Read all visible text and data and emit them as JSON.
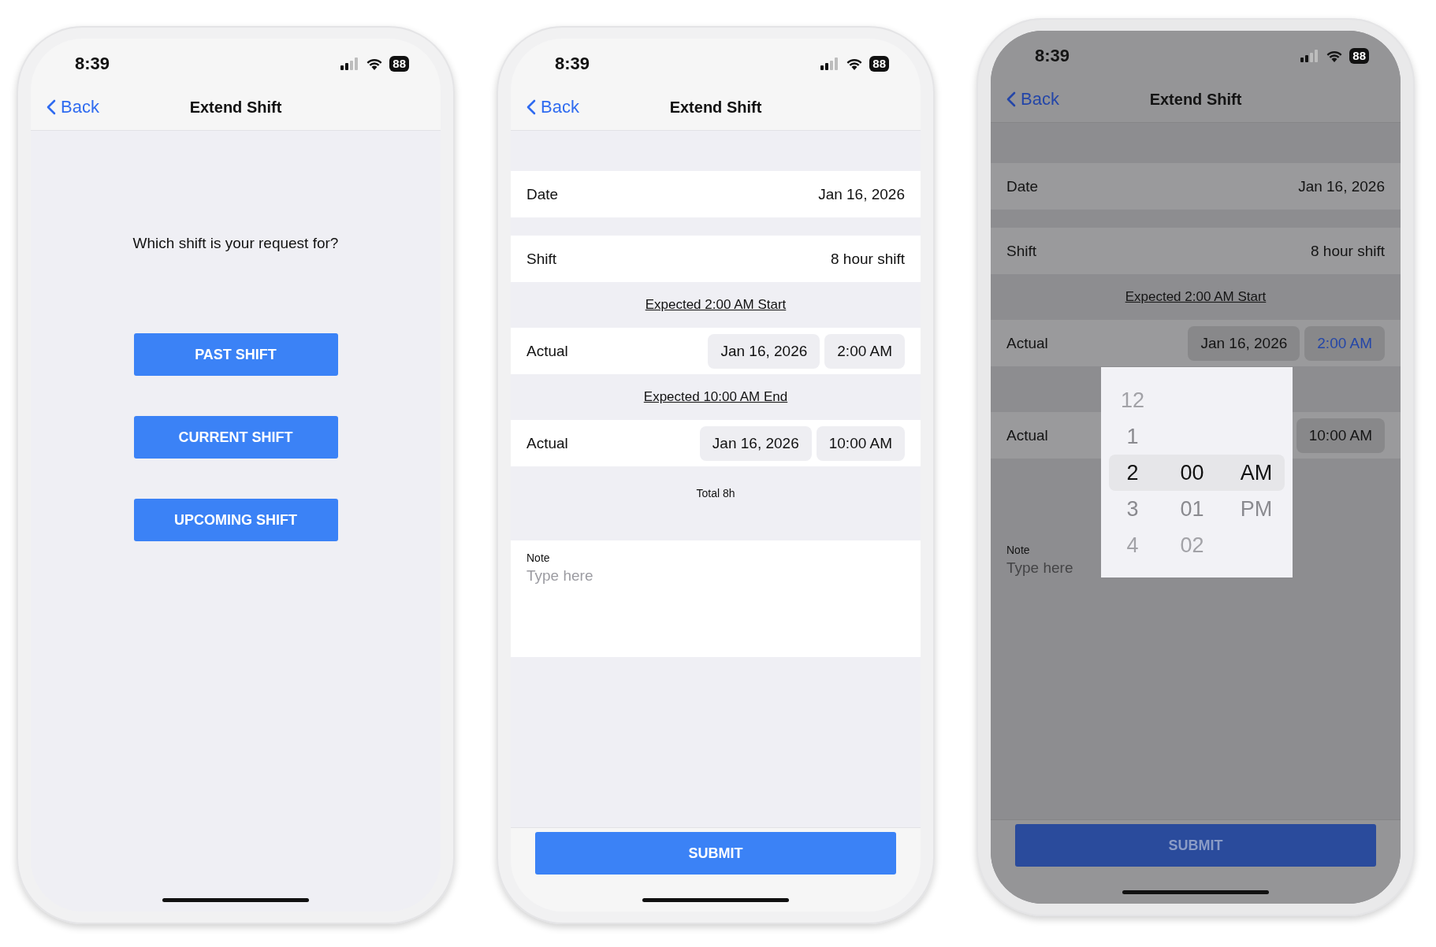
{
  "screens": [
    {
      "kind": "chooser",
      "dimmed": false,
      "status": {
        "time": "8:39",
        "battery": "88"
      },
      "nav": {
        "back": "Back",
        "title": "Extend Shift"
      },
      "prompt": "Which shift is your request for?",
      "buttons": [
        "PAST SHIFT",
        "CURRENT SHIFT",
        "UPCOMING SHIFT"
      ]
    },
    {
      "kind": "form",
      "dimmed": false,
      "status": {
        "time": "8:39",
        "battery": "88"
      },
      "nav": {
        "back": "Back",
        "title": "Extend Shift"
      },
      "rows": [
        {
          "kind": "field",
          "label": "Date",
          "value": "Jan 16, 2026"
        },
        {
          "kind": "field",
          "label": "Shift",
          "value": "8 hour shift"
        },
        {
          "kind": "header",
          "text": "Expected 2:00 AM Start"
        },
        {
          "kind": "actual",
          "label": "Actual",
          "date": "Jan 16, 2026",
          "time": {
            "text": "2:00 AM",
            "selected": false
          }
        },
        {
          "kind": "header",
          "text": "Expected 10:00 AM End"
        },
        {
          "kind": "actual",
          "label": "Actual",
          "date": "Jan 16, 2026",
          "time": {
            "text": "10:00 AM",
            "selected": false
          }
        }
      ],
      "total": "Total 8h",
      "note": {
        "label": "Note",
        "placeholder": "Type here"
      },
      "submit": "SUBMIT"
    },
    {
      "kind": "form",
      "dimmed": true,
      "status": {
        "time": "8:39",
        "battery": "88"
      },
      "nav": {
        "back": "Back",
        "title": "Extend Shift"
      },
      "rows": [
        {
          "kind": "field",
          "label": "Date",
          "value": "Jan 16, 2026"
        },
        {
          "kind": "field",
          "label": "Shift",
          "value": "8 hour shift"
        },
        {
          "kind": "header",
          "text": "Expected 2:00 AM Start"
        },
        {
          "kind": "actual",
          "label": "Actual",
          "date": "Jan 16, 2026",
          "time": {
            "text": "2:00 AM",
            "selected": true
          }
        },
        {
          "kind": "header"
        },
        {
          "kind": "actual",
          "label": "Actual",
          "time": {
            "text": "10:00 AM",
            "selected": false
          }
        }
      ],
      "note": {
        "label": "Note",
        "placeholder": "Type here"
      },
      "submit": "SUBMIT",
      "picker": {
        "columns": [
          {
            "items": [
              {
                "text": "12",
                "selected": false
              },
              {
                "text": "1",
                "selected": false
              },
              {
                "text": "2",
                "selected": true
              },
              {
                "text": "3",
                "selected": false
              },
              {
                "text": "4",
                "selected": false
              }
            ]
          },
          {
            "items": [
              {
                "text": "00",
                "selected": true
              },
              {
                "text": "01",
                "selected": false
              },
              {
                "text": "02",
                "selected": false
              }
            ]
          },
          {
            "items": [
              {
                "text": "AM",
                "selected": true
              },
              {
                "text": "PM",
                "selected": false
              }
            ]
          }
        ]
      }
    }
  ]
}
